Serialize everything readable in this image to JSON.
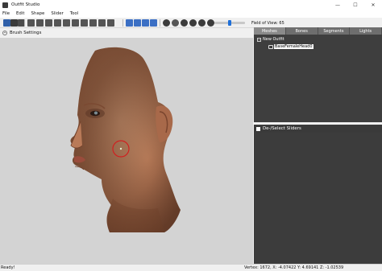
{
  "window": {
    "title": "Outfit Studio",
    "minimize_glyph": "—",
    "maximize_glyph": "☐",
    "close_glyph": "✕"
  },
  "menu": {
    "items": [
      {
        "label": "File"
      },
      {
        "label": "Edit"
      },
      {
        "label": "Shape"
      },
      {
        "label": "Slider"
      },
      {
        "label": "Tool"
      }
    ]
  },
  "toolbar": {
    "buttons": [
      {
        "icon": "select-brush-icon",
        "color": "#2f5fa8"
      },
      {
        "icon": "transform-icon",
        "color": "#3a3a3a"
      },
      {
        "icon": "pivot-icon",
        "color": "#4a4a4a"
      },
      {
        "icon": "vertex-select-icon",
        "color": "#555555"
      },
      {
        "icon": "mask-brush-icon",
        "color": "#555555"
      },
      {
        "icon": "inflate-brush-icon",
        "color": "#555555"
      },
      {
        "icon": "deflate-brush-icon",
        "color": "#555555"
      },
      {
        "icon": "move-brush-icon",
        "color": "#555555"
      },
      {
        "icon": "smooth-brush-icon",
        "color": "#555555"
      },
      {
        "icon": "weight-brush-icon",
        "color": "#555555"
      },
      {
        "icon": "color-brush-icon",
        "color": "#555555"
      },
      {
        "icon": "alpha-brush-icon",
        "color": "#555555"
      },
      {
        "icon": "collision-brush-icon",
        "color": "#555555"
      },
      {
        "icon": "front-view-icon",
        "color": "#3b6fc4"
      },
      {
        "icon": "back-view-icon",
        "color": "#3b6fc4"
      },
      {
        "icon": "left-view-icon",
        "color": "#3b6fc4"
      },
      {
        "icon": "right-view-icon",
        "color": "#3b6fc4"
      },
      {
        "icon": "perspective-icon",
        "color": "#3b3b3b"
      },
      {
        "icon": "show-nodes-icon",
        "color": "#555555"
      },
      {
        "icon": "wireframe-icon",
        "color": "#3b3b3b"
      },
      {
        "icon": "lighting-icon",
        "color": "#3b3b3b"
      },
      {
        "icon": "texture-icon",
        "color": "#3b3b3b"
      },
      {
        "icon": "mask-display-icon",
        "color": "#3b3b3b"
      }
    ],
    "fov_label": "Field of View: 65"
  },
  "brush": {
    "toggle_glyph": "^",
    "label": "Brush Settings"
  },
  "right_panel": {
    "tabs": [
      {
        "label": "Meshes",
        "active": true
      },
      {
        "label": "Bones",
        "active": false
      },
      {
        "label": "Segments",
        "active": false
      },
      {
        "label": "Lights",
        "active": false
      }
    ],
    "tree": {
      "expander_glyph": "−",
      "root_label": "New Outfit",
      "mesh_label": "BaseFemaleHead0"
    },
    "sliders_header": "De-/Select Sliders"
  },
  "status": {
    "left": "Ready!",
    "right": "Vertex: 1672, X: -4.07422 Y: 4.69141 Z: -1.02539"
  },
  "colors": {
    "viewport_bg": "#d3d3d3",
    "panel_dark": "#3c3c3c",
    "brush_ring": "#d02020",
    "skin": "#b87a58"
  }
}
